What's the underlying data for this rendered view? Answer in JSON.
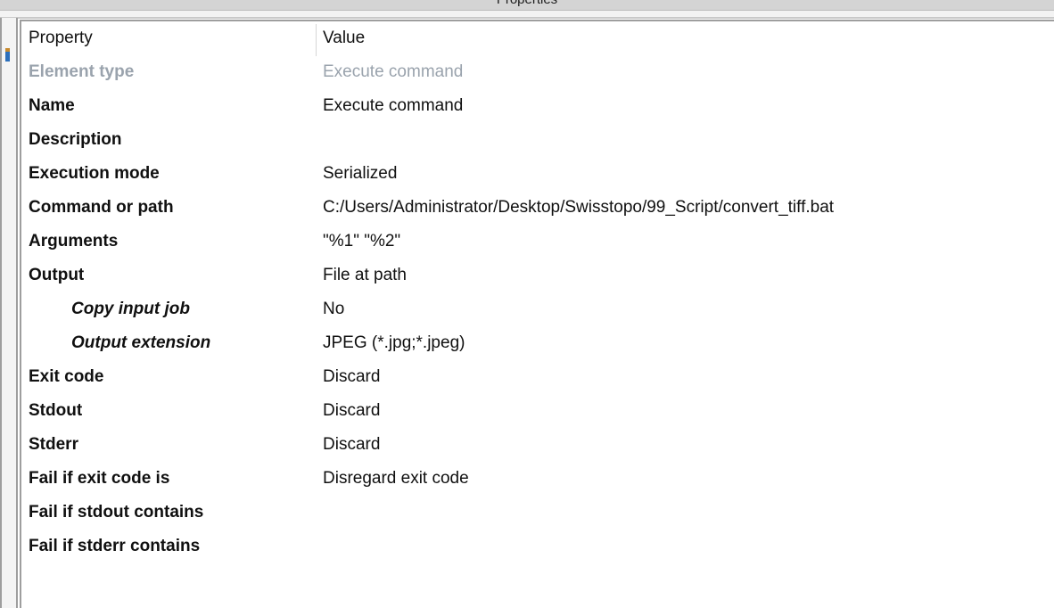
{
  "window": {
    "title": "Properties"
  },
  "table": {
    "headers": {
      "property": "Property",
      "value": "Value"
    },
    "rows": [
      {
        "property": "Element type",
        "value": "Execute command",
        "style": "muted",
        "indent": false
      },
      {
        "property": "Name",
        "value": "Execute command",
        "style": "bold",
        "indent": false
      },
      {
        "property": "Description",
        "value": "",
        "style": "bold",
        "indent": false
      },
      {
        "property": "Execution mode",
        "value": "Serialized",
        "style": "bold",
        "indent": false
      },
      {
        "property": "Command or path",
        "value": "C:/Users/Administrator/Desktop/Swisstopo/99_Script/convert_tiff.bat",
        "style": "bold",
        "indent": false
      },
      {
        "property": "Arguments",
        "value": "\"%1\" \"%2\"",
        "style": "bold",
        "indent": false
      },
      {
        "property": "Output",
        "value": "File at path",
        "style": "bold",
        "indent": false
      },
      {
        "property": "Copy input job",
        "value": "No",
        "style": "sub",
        "indent": true
      },
      {
        "property": "Output extension",
        "value": "JPEG (*.jpg;*.jpeg)",
        "style": "sub",
        "indent": true
      },
      {
        "property": "Exit code",
        "value": "Discard",
        "style": "bold",
        "indent": false
      },
      {
        "property": "Stdout",
        "value": "Discard",
        "style": "bold",
        "indent": false
      },
      {
        "property": "Stderr",
        "value": "Discard",
        "style": "bold",
        "indent": false
      },
      {
        "property": "Fail if exit code is",
        "value": "Disregard exit code",
        "style": "bold",
        "indent": false
      },
      {
        "property": "Fail if stdout contains",
        "value": "",
        "style": "bold",
        "indent": false
      },
      {
        "property": "Fail if stderr contains",
        "value": "",
        "style": "bold",
        "indent": false
      }
    ]
  },
  "colors": {
    "chrome": "#d4d4d4",
    "panel_border": "#9e9e9e",
    "text": "#101010",
    "muted_text": "#9aa3ad",
    "rail_marker": "#2c6fbb"
  }
}
